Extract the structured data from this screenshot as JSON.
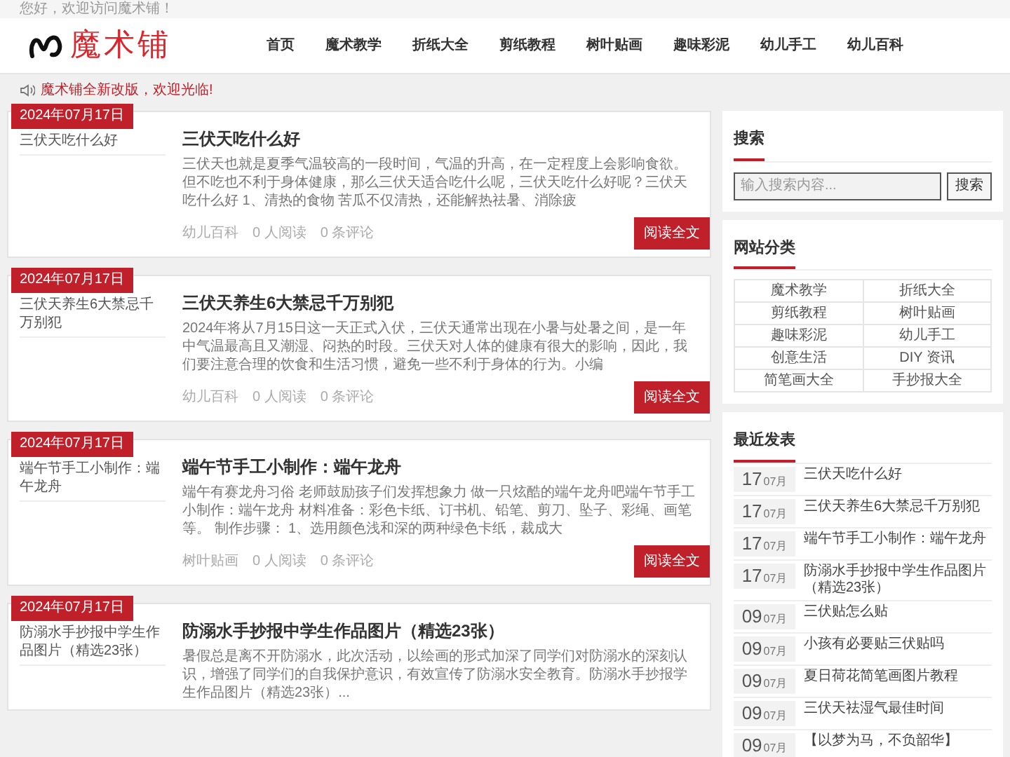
{
  "top_bar": {
    "greeting": "您好，欢迎访问魔术铺！"
  },
  "header": {
    "logo_text": "魔术铺",
    "nav": [
      "首页",
      "魔术教学",
      "折纸大全",
      "剪纸教程",
      "树叶贴画",
      "趣味彩泥",
      "幼儿手工",
      "幼儿百科"
    ]
  },
  "notice": {
    "text": "魔术铺全新改版，欢迎光临!"
  },
  "posts": [
    {
      "date": "2024年07月17日",
      "image_alt": "三伏天吃什么好",
      "title": "三伏天吃什么好",
      "summary": "三伏天也就是夏季气温较高的一段时间，气温的升高，在一定程度上会影响食欲。但不吃也不利于身体健康，那么三伏天适合吃什么呢，三伏天吃什么好呢？三伏天吃什么好 1、清热的食物 苦瓜不仅清热，还能解热祛暑、消除疲",
      "category": "幼儿百科",
      "reads": "0 人阅读",
      "comments": "0 条评论",
      "button": "阅读全文"
    },
    {
      "date": "2024年07月17日",
      "image_alt": "三伏天养生6大禁忌千万别犯",
      "title": "三伏天养生6大禁忌千万别犯",
      "summary": "2024年将从7月15日这一天正式入伏，三伏天通常出现在小暑与处暑之间，是一年中气温最高且又潮湿、闷热的时段。三伏天对人体的健康有很大的影响，因此，我们要注意合理的饮食和生活习惯，避免一些不利于身体的行为。小编",
      "category": "幼儿百科",
      "reads": "0 人阅读",
      "comments": "0 条评论",
      "button": "阅读全文"
    },
    {
      "date": "2024年07月17日",
      "image_alt": "端午节手工小制作：端午龙舟",
      "title": "端午节手工小制作：端午龙舟",
      "summary": "端午有赛龙舟习俗 老师鼓励孩子们发挥想象力 做一只炫酷的端午龙舟吧端午节手工小制作：端午龙舟 材料准备：彩色卡纸、订书机、铅笔、剪刀、坠子、彩绳、画笔等。 制作步骤： 1、选用颜色浅和深的两种绿色卡纸，裁成大",
      "category": "树叶贴画",
      "reads": "0 人阅读",
      "comments": "0 条评论",
      "button": "阅读全文"
    },
    {
      "date": "2024年07月17日",
      "image_alt": "防溺水手抄报中学生作品图片（精选23张）",
      "title": "防溺水手抄报中学生作品图片（精选23张）",
      "summary": "暑假总是离不开防溺水，此次活动，以绘画的形式加深了同学们对防溺水的深刻认识，增强了同学们的自我保护意识，有效宣传了防溺水安全教育。防溺水手抄报学生作品图片（精选23张）..."
    }
  ],
  "sidebar": {
    "search": {
      "title": "搜索",
      "placeholder": "输入搜索内容...",
      "button": "搜索"
    },
    "categories": {
      "title": "网站分类",
      "items": [
        "魔术教学",
        "折纸大全",
        "剪纸教程",
        "树叶贴画",
        "趣味彩泥",
        "幼儿手工",
        "创意生活",
        "DIY 资讯",
        "简笔画大全",
        "手抄报大全"
      ]
    },
    "recent": {
      "title": "最近发表",
      "items": [
        {
          "day": "17",
          "month": "07月",
          "title": "三伏天吃什么好"
        },
        {
          "day": "17",
          "month": "07月",
          "title": "三伏天养生6大禁忌千万别犯"
        },
        {
          "day": "17",
          "month": "07月",
          "title": "端午节手工小制作：端午龙舟"
        },
        {
          "day": "17",
          "month": "07月",
          "title": "防溺水手抄报中学生作品图片（精选23张）"
        },
        {
          "day": "09",
          "month": "07月",
          "title": "三伏贴怎么贴"
        },
        {
          "day": "09",
          "month": "07月",
          "title": "小孩有必要贴三伏贴吗"
        },
        {
          "day": "09",
          "month": "07月",
          "title": "夏日荷花简笔画图片教程"
        },
        {
          "day": "09",
          "month": "07月",
          "title": "三伏天祛湿气最佳时间"
        },
        {
          "day": "09",
          "month": "07月",
          "title": "【以梦为马，不负韶华】"
        }
      ]
    }
  }
}
